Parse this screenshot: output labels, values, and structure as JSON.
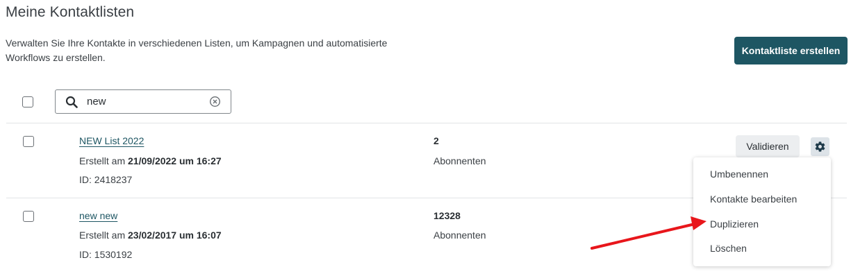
{
  "header": {
    "title": "Meine Kontaktlisten",
    "description": "Verwalten Sie Ihre Kontakte in verschiedenen Listen, um Kampagnen und automatisierte Workflows zu erstellen.",
    "create_button": "Kontaktliste erstellen",
    "accent_color": "#1e5663"
  },
  "search": {
    "value": "new",
    "search_icon": "search-icon",
    "clear_icon": "clear-circle-icon"
  },
  "lists": [
    {
      "name": "NEW List 2022",
      "created_prefix": "Erstellt am",
      "created_date": "21/09/2022 um 16:27",
      "id": "ID: 2418237",
      "count": "2",
      "count_label": "Abonnenten",
      "validate_button": "Validieren",
      "settings_icon": "gear-icon"
    },
    {
      "name": "new new",
      "created_prefix": "Erstellt am",
      "created_date": "23/02/2017 um 16:07",
      "id": "ID: 1530192",
      "count": "12328",
      "count_label": "Abonnenten"
    }
  ],
  "context_menu": {
    "items": [
      "Umbenennen",
      "Kontakte bearbeiten",
      "Duplizieren",
      "Löschen"
    ]
  },
  "annotation": {
    "arrow_color": "#e8161b"
  }
}
